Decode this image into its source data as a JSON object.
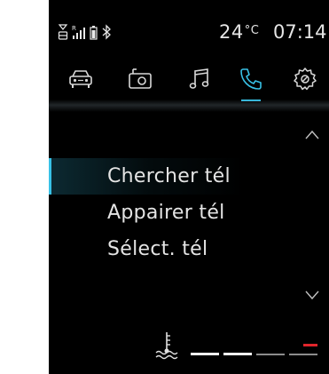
{
  "status": {
    "temperature_value": "24",
    "temperature_unit": "°C",
    "time": "07:14",
    "icons": [
      "gps-signal-icon",
      "cellular-signal-icon",
      "battery-icon",
      "bluetooth-icon"
    ]
  },
  "tabs": [
    {
      "name": "car-icon",
      "active": false
    },
    {
      "name": "radio-icon",
      "active": false
    },
    {
      "name": "music-icon",
      "active": false
    },
    {
      "name": "phone-icon",
      "active": true
    },
    {
      "name": "settings-icon",
      "active": false
    }
  ],
  "menu": {
    "items": [
      {
        "label": "Chercher tél",
        "selected": true
      },
      {
        "label": "Appairer tél",
        "selected": false
      },
      {
        "label": "Sélect. tél",
        "selected": false
      }
    ]
  },
  "gauge": {
    "icon": "coolant-temperature-icon",
    "level_segments_lit": 3,
    "segments_total": 4,
    "warning_color": "#e0252b"
  },
  "colors": {
    "accent": "#38c1e6",
    "background": "#000000",
    "text": "#e4e4e4"
  }
}
